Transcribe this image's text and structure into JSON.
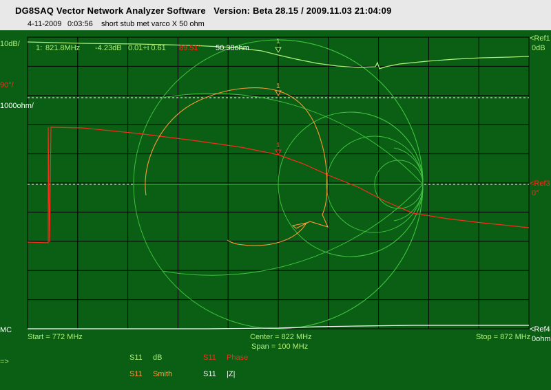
{
  "window": {
    "title": "DG8SAQ Vector Network Analyzer Software",
    "version": "Version:  Beta 28.15 / 2009.11.03 21:04:09"
  },
  "info": {
    "date": "4-11-2009",
    "time": "0:03:56",
    "note": "short stub met varco X 50 ohm"
  },
  "scales": {
    "db_scale": "10dB/",
    "phase_scale": "90°/",
    "ohm_scale": "1000ohm/",
    "mc": "MC"
  },
  "refs": {
    "ref1": "<Ref1",
    "ref1_val": "0dB",
    "ref3": "<Ref3",
    "ref3_val": "0°",
    "ref4": "<Ref4",
    "ref4_val": "0ohm"
  },
  "marker_readout": {
    "index": "1:",
    "freq": "821.8MHz",
    "db": "-4.23dB",
    "complex": "0.01+i 0.61",
    "phase": "89.51°",
    "ohm": "50.38ohm"
  },
  "markers": {
    "label": "1"
  },
  "freq_axis": {
    "start": "Start = 772 MHz",
    "center": "Center = 822 MHz",
    "span": "Span = 100 MHz",
    "stop": "Stop = 872 MHz"
  },
  "legend": {
    "row1": [
      {
        "param": "S11",
        "unit": "dB",
        "color": "#aef07a"
      },
      {
        "param": "S11",
        "unit": "Phase",
        "color": "#ff2a1a"
      }
    ],
    "row2": [
      {
        "param": "S11",
        "unit": "Smith",
        "color": "#ff9a3a"
      },
      {
        "param": "S11",
        "unit": "|Z|",
        "color": "#ffffff"
      }
    ]
  },
  "arrow_hint": "=>",
  "colors": {
    "background": "#0a5f14",
    "grid": "#000000",
    "smith": "#3fbf3f",
    "trace_db": "#aef07a",
    "trace_phase": "#ff2a1a",
    "trace_smith": "#ff9a3a",
    "trace_z": "#ffffff"
  }
}
